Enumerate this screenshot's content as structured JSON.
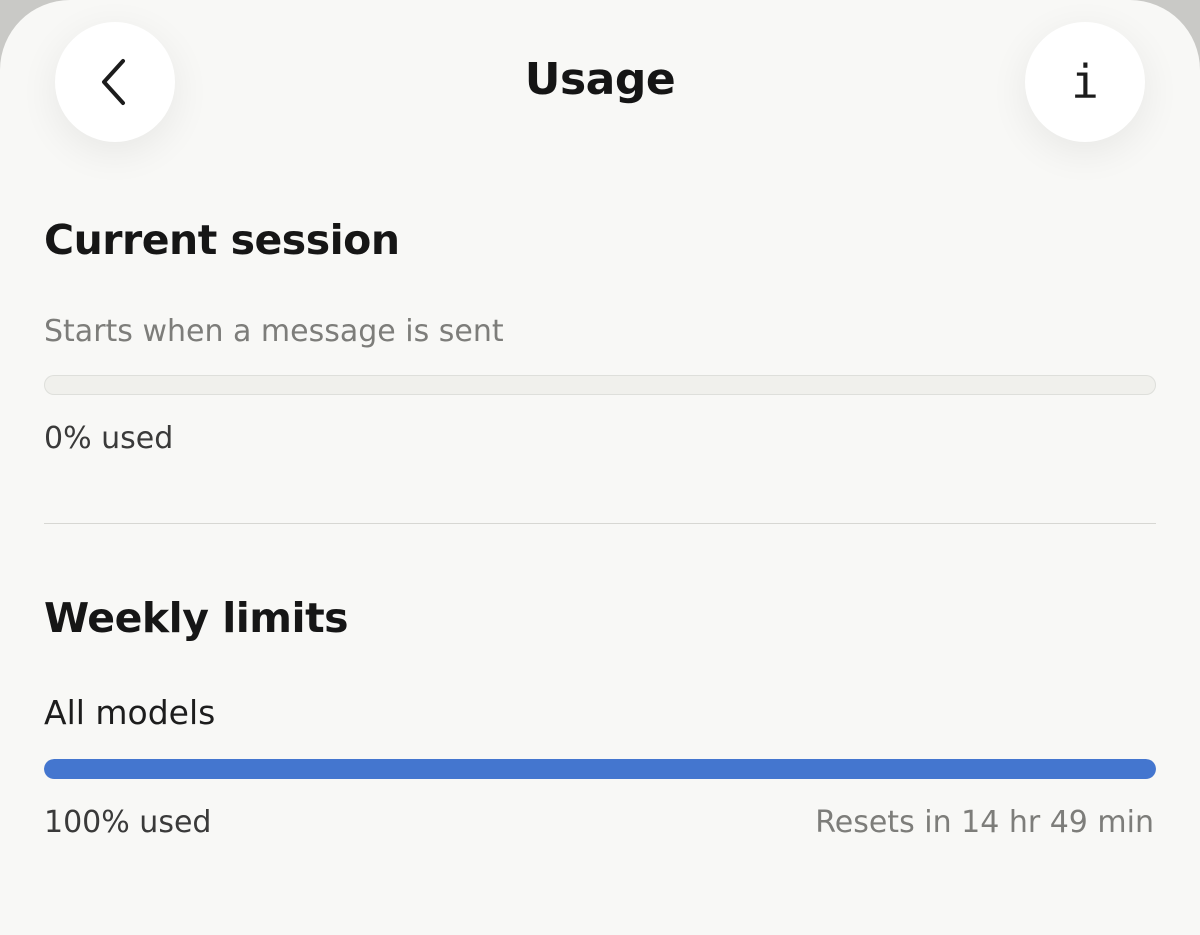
{
  "header": {
    "title": "Usage",
    "back_icon": "chevron-left-icon",
    "info_icon": "info-icon",
    "info_glyph": "i"
  },
  "current_session": {
    "heading": "Current session",
    "subtitle": "Starts when a message is sent",
    "used_fraction": 0,
    "used_label": "0% used"
  },
  "weekly_limits": {
    "heading": "Weekly limits",
    "models": [
      {
        "label": "All models",
        "used_fraction": 1,
        "used_label": "100% used",
        "reset_label": "Resets in 14 hr 49 min"
      }
    ]
  },
  "colors": {
    "background": "#f8f8f6",
    "progress_fill": "#4476cf",
    "muted_text": "#7d7d7a"
  }
}
